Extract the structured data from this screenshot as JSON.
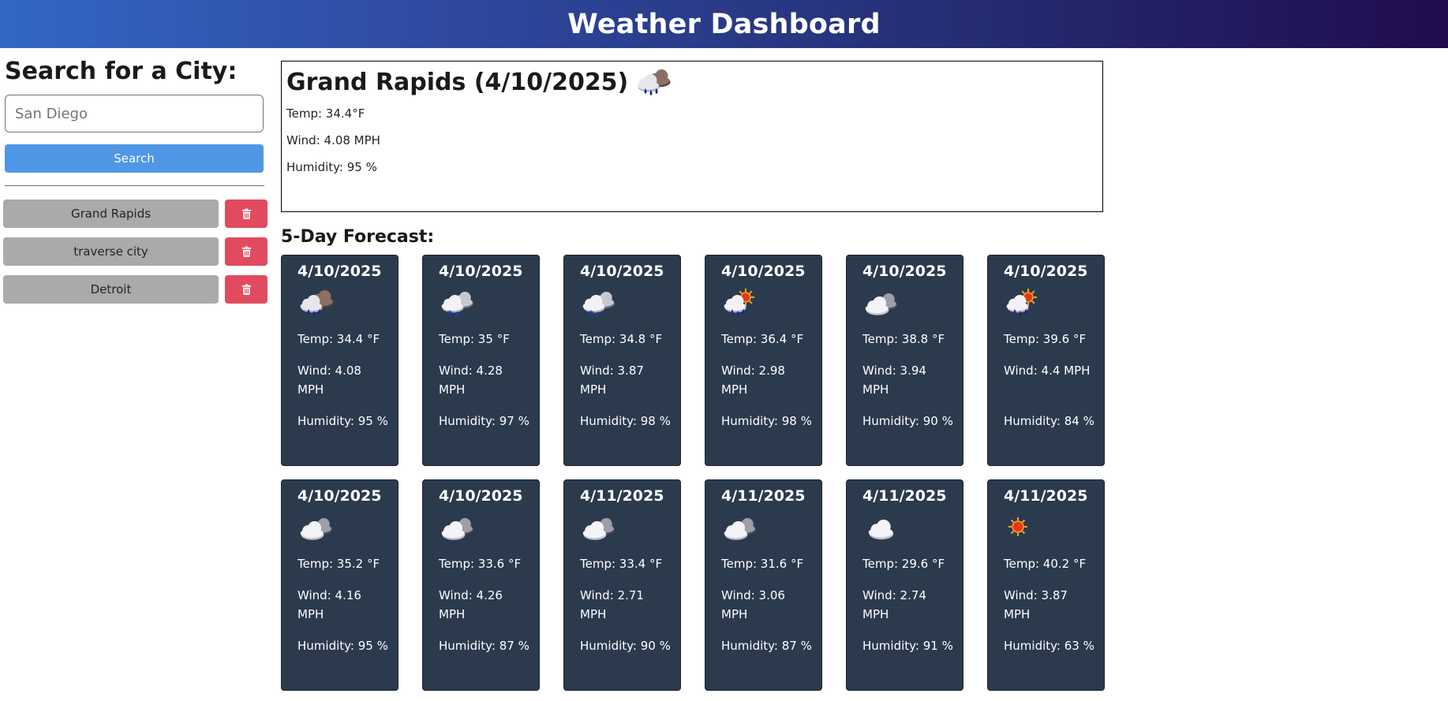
{
  "app": {
    "title": "Weather Dashboard"
  },
  "sidebar": {
    "heading": "Search for a City:",
    "search_placeholder": "San Diego",
    "search_value": "",
    "search_button": "Search",
    "history": [
      {
        "city": "Grand Rapids",
        "delete_icon": "trash-icon"
      },
      {
        "city": "traverse city",
        "delete_icon": "trash-icon"
      },
      {
        "city": "Detroit",
        "delete_icon": "trash-icon"
      }
    ]
  },
  "today": {
    "title": "Grand Rapids (4/10/2025)",
    "icon": "rain-cloud-icon",
    "temp": "Temp: 34.4°F",
    "wind": "Wind: 4.08 MPH",
    "humidity": "Humidity: 95 %"
  },
  "forecast": {
    "heading": "5-Day Forecast:",
    "cards": [
      {
        "date": "4/10/2025",
        "icon": "rain-cloud-icon",
        "temp": "Temp: 34.4 °F",
        "wind": "Wind: 4.08 MPH",
        "humidity": "Humidity: 95 %"
      },
      {
        "date": "4/10/2025",
        "icon": "snow-cloud-icon",
        "temp": "Temp: 35 °F",
        "wind": "Wind: 4.28 MPH",
        "humidity": "Humidity: 97 %"
      },
      {
        "date": "4/10/2025",
        "icon": "snow-cloud-icon",
        "temp": "Temp: 34.8 °F",
        "wind": "Wind: 3.87 MPH",
        "humidity": "Humidity: 98 %"
      },
      {
        "date": "4/10/2025",
        "icon": "sun-rain-cloud-icon",
        "temp": "Temp: 36.4 °F",
        "wind": "Wind: 2.98 MPH",
        "humidity": "Humidity: 98 %"
      },
      {
        "date": "4/10/2025",
        "icon": "cloudy-icon",
        "temp": "Temp: 38.8 °F",
        "wind": "Wind: 3.94 MPH",
        "humidity": "Humidity: 90 %"
      },
      {
        "date": "4/10/2025",
        "icon": "sun-rain-cloud-icon",
        "temp": "Temp: 39.6 °F",
        "wind": "Wind: 4.4 MPH",
        "humidity": "Humidity: 84 %"
      },
      {
        "date": "4/10/2025",
        "icon": "cloudy-icon",
        "temp": "Temp: 35.2 °F",
        "wind": "Wind: 4.16 MPH",
        "humidity": "Humidity: 95 %"
      },
      {
        "date": "4/10/2025",
        "icon": "cloudy-icon",
        "temp": "Temp: 33.6 °F",
        "wind": "Wind: 4.26 MPH",
        "humidity": "Humidity: 87 %"
      },
      {
        "date": "4/11/2025",
        "icon": "cloudy-icon",
        "temp": "Temp: 33.4 °F",
        "wind": "Wind: 2.71 MPH",
        "humidity": "Humidity: 90 %"
      },
      {
        "date": "4/11/2025",
        "icon": "cloudy-icon",
        "temp": "Temp: 31.6 °F",
        "wind": "Wind: 3.06 MPH",
        "humidity": "Humidity: 87 %"
      },
      {
        "date": "4/11/2025",
        "icon": "cloud-icon",
        "temp": "Temp: 29.6 °F",
        "wind": "Wind: 2.74 MPH",
        "humidity": "Humidity: 91 %"
      },
      {
        "date": "4/11/2025",
        "icon": "sun-icon",
        "temp": "Temp: 40.2 °F",
        "wind": "Wind: 3.87 MPH",
        "humidity": "Humidity: 63 %"
      }
    ]
  },
  "colors": {
    "header_gradient_start": "#3367c6",
    "header_gradient_end": "#210b4e",
    "search_button": "#4f97e6",
    "history_button": "#aaaaaa",
    "delete_button": "#e24a5f",
    "card_background": "#2c3a4e"
  }
}
